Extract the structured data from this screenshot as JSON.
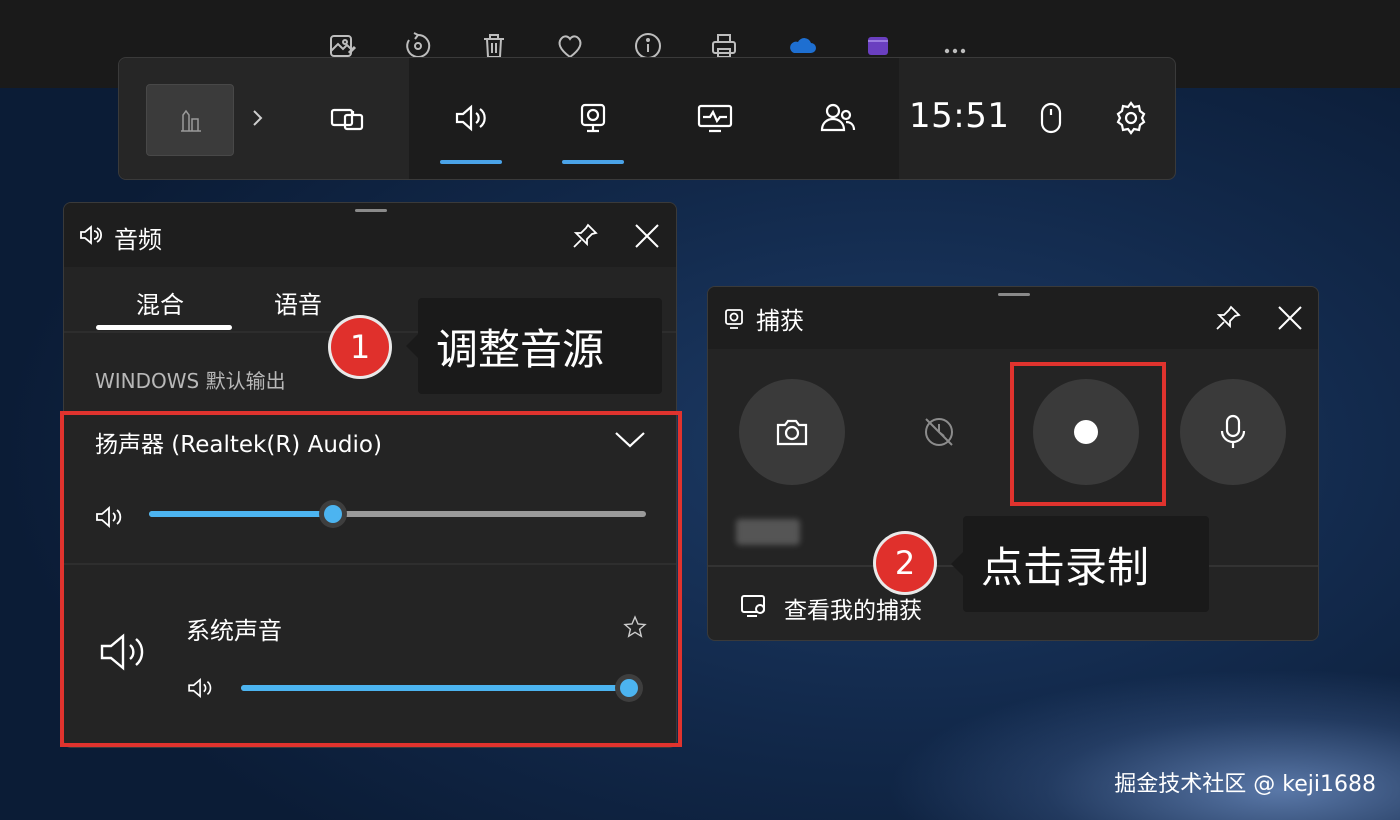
{
  "top_toolbar": {
    "icons": [
      "edit-image-icon",
      "rotate-icon",
      "delete-icon",
      "favorite-icon",
      "info-icon",
      "print-icon",
      "onedrive-icon",
      "clipchamp-icon",
      "more-icon"
    ]
  },
  "game_bar": {
    "time": "15:51",
    "widgets": [
      "widget-menu",
      "audio",
      "capture",
      "performance",
      "social"
    ],
    "active_widgets": [
      "audio",
      "capture"
    ],
    "accent_color": "#4aa3e8"
  },
  "audio_panel": {
    "title": "音频",
    "tabs": [
      {
        "label": "混合",
        "active": true
      },
      {
        "label": "语音",
        "active": false
      }
    ],
    "section_label": "WINDOWS 默认输出",
    "output_device": "扬声器 (Realtek(R) Audio)",
    "master_volume_percent": 37,
    "apps": [
      {
        "name": "系统声音",
        "volume_percent": 100
      }
    ]
  },
  "capture_panel": {
    "title": "捕获",
    "buttons": [
      "screenshot",
      "record-last-30s",
      "start-recording",
      "microphone"
    ],
    "gallery_link": "查看我的捕获"
  },
  "annotations": [
    {
      "number": "1",
      "text": "调整音源"
    },
    {
      "number": "2",
      "text": "点击录制"
    }
  ],
  "highlight_color": "#e0332e",
  "watermark": "掘金技术社区 @ keji1688"
}
